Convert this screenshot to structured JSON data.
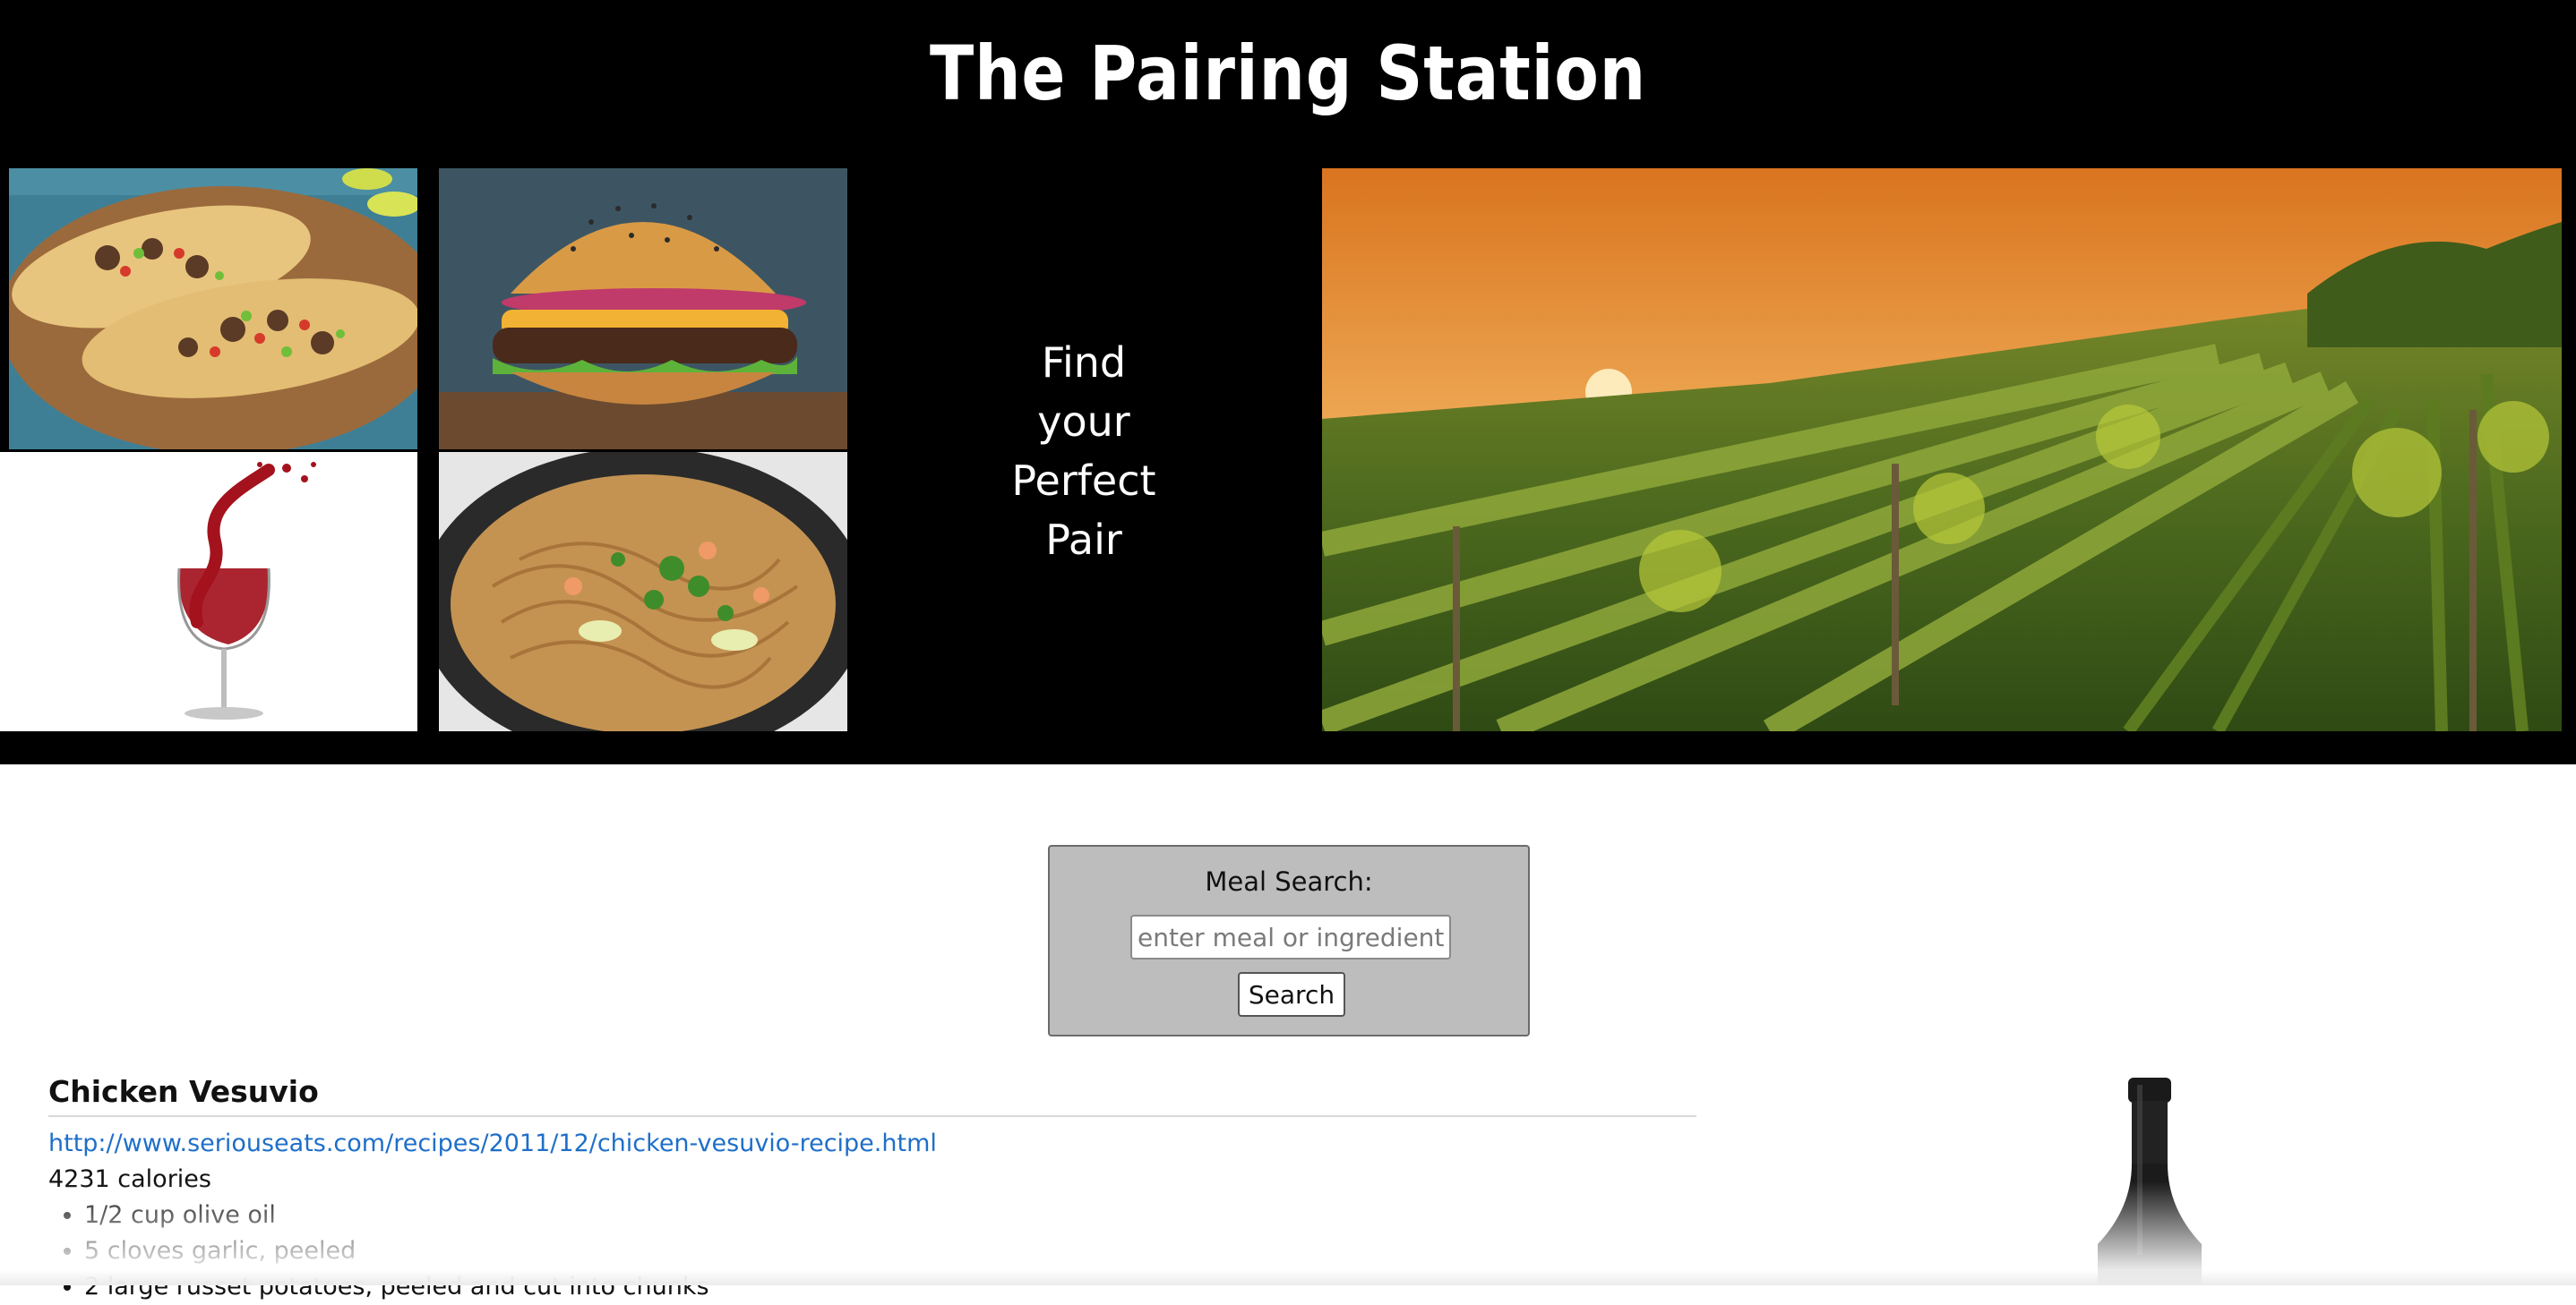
{
  "header": {
    "title": "The Pairing Station",
    "tagline": [
      "Find",
      "your",
      "Perfect",
      "Pair"
    ]
  },
  "images": {
    "tacos": "tacos-image",
    "wine_glass": "wine-glass-image",
    "burger": "burger-image",
    "noodles": "noodles-image",
    "vineyard": "vineyard-image",
    "bottle": "wine-bottle-image"
  },
  "search": {
    "label": "Meal Search:",
    "placeholder": "enter meal or ingredient",
    "value": "",
    "button_label": "Search"
  },
  "result": {
    "title": "Chicken Vesuvio",
    "url": "http://www.seriouseats.com/recipes/2011/12/chicken-vesuvio-recipe.html",
    "calories": "4231 calories",
    "ingredients": [
      "1/2 cup olive oil",
      "5 cloves garlic, peeled",
      "2 large russet potatoes, peeled and cut into chunks"
    ]
  },
  "colors": {
    "header_bg": "#000000",
    "search_box_bg": "#bdbdbd",
    "link": "#1e6fc9"
  }
}
